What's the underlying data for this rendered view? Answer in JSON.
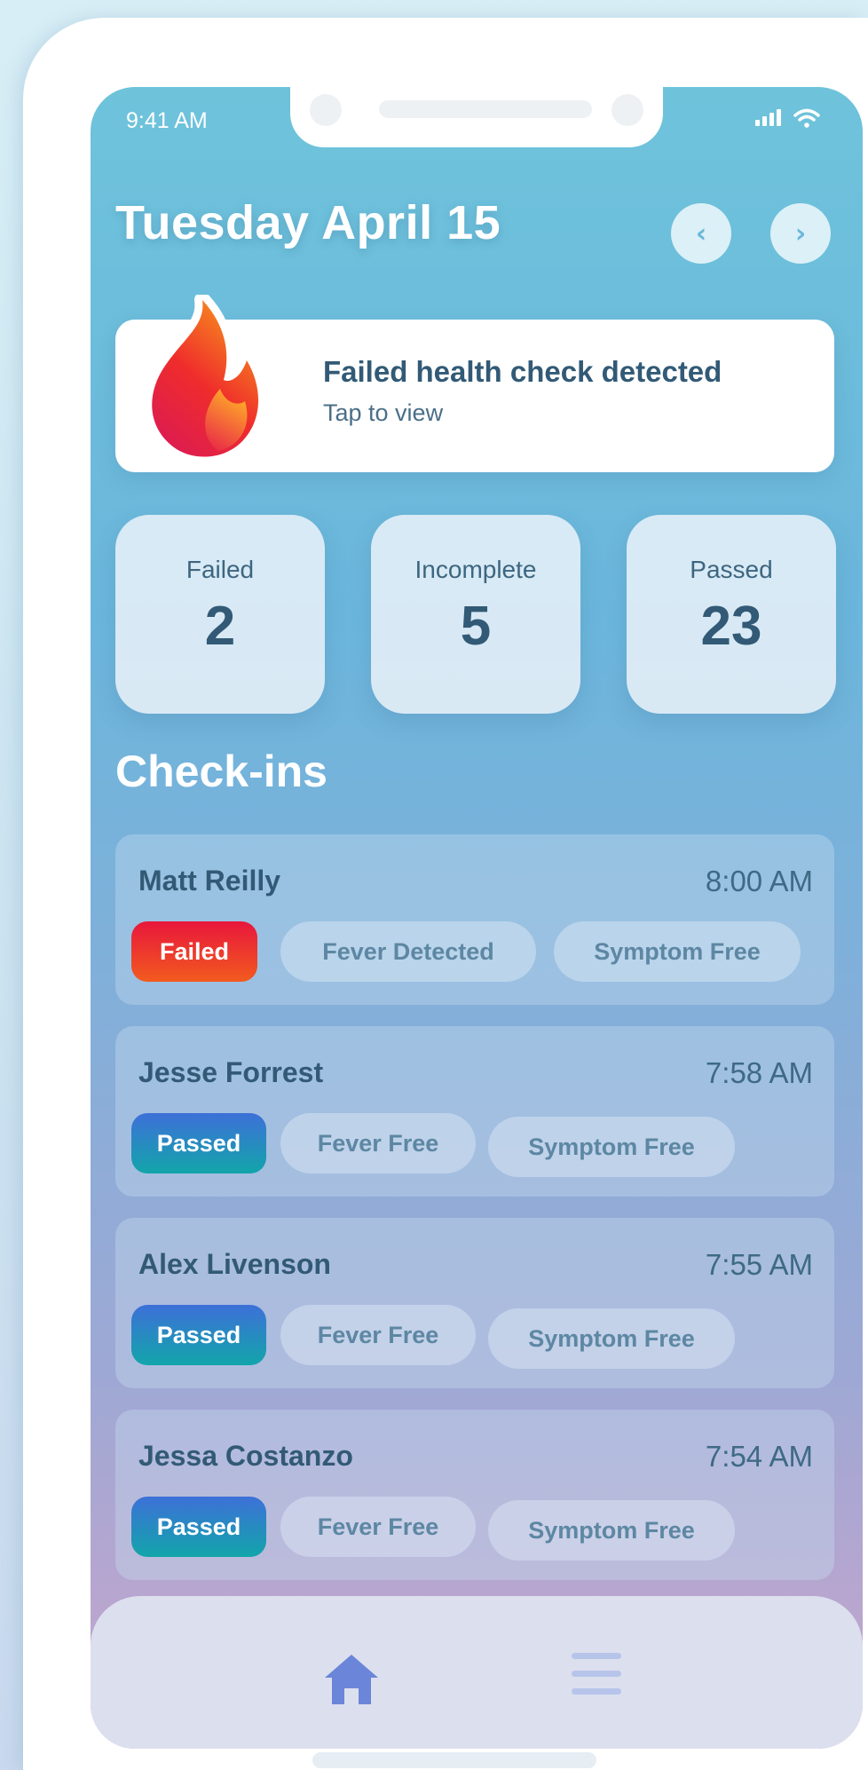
{
  "status_bar": {
    "time": "9:41 AM"
  },
  "header": {
    "date_title": "Tuesday April 15",
    "prev_glyph": "‹",
    "next_glyph": "›"
  },
  "alert": {
    "title": "Failed health check detected",
    "subtitle": "Tap to view",
    "icon": "flame-icon"
  },
  "stats": [
    {
      "label": "Failed",
      "value": "2"
    },
    {
      "label": "Incomplete",
      "value": "5"
    },
    {
      "label": "Passed",
      "value": "23"
    }
  ],
  "section": {
    "title": "Check-ins"
  },
  "checkins": [
    {
      "name": "Matt Reilly",
      "time": "8:00 AM",
      "status": "Failed",
      "fever": "Fever Detected",
      "symptom": "Symptom Free"
    },
    {
      "name": "Jesse Forrest",
      "time": "7:58 AM",
      "status": "Passed",
      "fever": "Fever Free",
      "symptom": "Symptom Free"
    },
    {
      "name": "Alex Livenson",
      "time": "7:55 AM",
      "status": "Passed",
      "fever": "Fever Free",
      "symptom": "Symptom Free"
    },
    {
      "name": "Jessa Costanzo",
      "time": "7:54 AM",
      "status": "Passed",
      "fever": "Fever Free",
      "symptom": "Symptom Free"
    }
  ],
  "tabbar": {
    "items": [
      "home-icon",
      "menu-icon"
    ]
  },
  "colors": {
    "failed": "#e8163c",
    "passed": "#3d70d8",
    "accent_text": "#325a76",
    "home_icon": "#6b86d8",
    "menu_icon": "#b7c4ea"
  }
}
